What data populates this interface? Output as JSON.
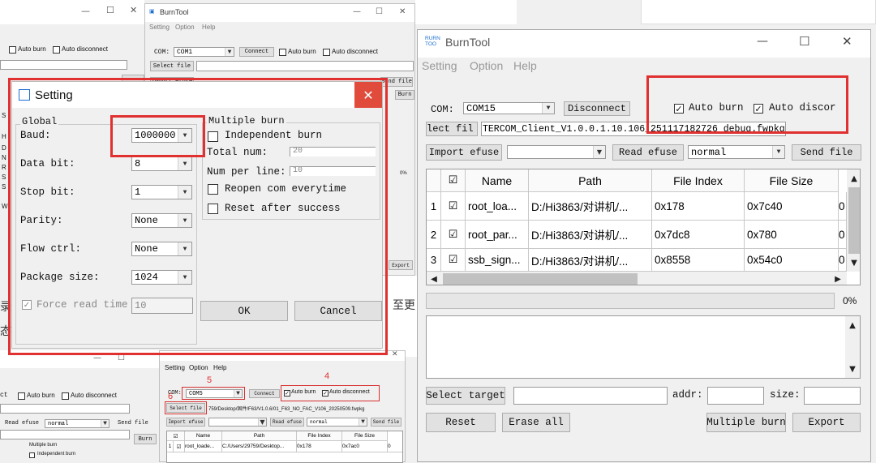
{
  "background_screens": {
    "top_left_window": {
      "auto_burn_label": "Auto burn",
      "auto_disconnect_label": "Auto disconnect",
      "side_letters": [
        "S",
        "H",
        "D",
        "N",
        "R",
        "S",
        "S",
        "W"
      ]
    },
    "top_middle_window": {
      "title": "BurnTool",
      "menu": [
        "Setting",
        "Option",
        "Help"
      ],
      "com_label": "COM:",
      "com_value": "COM1",
      "connect_label": "Connect",
      "auto_burn_label": "Auto burn",
      "auto_disconnect_label": "Auto disconnect",
      "select_file_label": "Select file",
      "import_efuse_label": "Import efuse",
      "send_file_label": "Send file",
      "burn_label": "Burn",
      "progress_text": "0%",
      "export_label": "Export"
    },
    "doc_text": {
      "left_char_1": "录",
      "left_char_2": "态",
      "right_text": "至更"
    },
    "bottom_left_window": {
      "ct_label": "ct",
      "auto_burn_label": "Auto burn",
      "auto_disconnect_label": "Auto disconnect",
      "read_efuse_label": "Read efuse",
      "mode_value": "normal",
      "send_file_label": "Send file",
      "multiple_burn_label": "Multiple burn",
      "independent_burn_label": "Independent burn",
      "burn_label": "Burn"
    },
    "bottom_middle_window": {
      "title": "BurnTool",
      "menu": [
        "Setting",
        "Option",
        "Help"
      ],
      "annotation_5": "5",
      "annotation_4": "4",
      "annotation_6": "6",
      "com_label": "COM:",
      "com_value": "COM5",
      "connect_label": "Connect",
      "auto_burn_label": "Auto burn",
      "auto_disconnect_label": "Auto disconnect",
      "select_file_label": "Select file",
      "file_path": "759/Desktop/固件/F63/V1.0.6/01_F63_NO_FAC_V106_20250509.fwpkg",
      "import_efuse_label": "Import efuse",
      "read_efuse_label": "Read efuse",
      "mode_value": "normal",
      "send_file_label": "Send file",
      "columns": [
        "Name",
        "Path",
        "File Index",
        "File Size"
      ],
      "row": {
        "num": "1",
        "name": "root_loade...",
        "path": "C:/Users/29759/Desktop...",
        "index": "0x178",
        "size": "0x7ac0",
        "extra": "0"
      }
    }
  },
  "setting_dialog": {
    "title": "Setting",
    "close_glyph": "✕",
    "global_group": "Global",
    "baud_label": "Baud:",
    "baud_value": "1000000",
    "data_bit_label": "Data bit:",
    "data_bit_value": "8",
    "stop_bit_label": "Stop bit:",
    "stop_bit_value": "1",
    "parity_label": "Parity:",
    "parity_value": "None",
    "flow_label": "Flow ctrl:",
    "flow_value": "None",
    "package_label": "Package size:",
    "package_value": "1024",
    "force_read_label": "Force read time",
    "force_read_value": "10",
    "multiple_group": "Multiple burn",
    "independent_label": "Independent burn",
    "total_num_label": "Total num:",
    "total_num_value": "20",
    "num_per_line_label": "Num per line:",
    "num_per_line_value": "10",
    "reopen_label": "Reopen com everytime",
    "reset_after_label": "Reset after success",
    "ok_label": "OK",
    "cancel_label": "Cancel"
  },
  "main_window": {
    "logo_text": "RURN\nTOO",
    "title": "BurnTool",
    "menu": [
      "Setting",
      "Option",
      "Help"
    ],
    "com_label": "COM:",
    "com_value": "COM15",
    "disconnect_label": "Disconnect",
    "auto_burn_label": "Auto burn",
    "auto_disconnect_label": "Auto discor",
    "select_file_label": "lect fil",
    "file_path": "TERCOM_Client_V1.0.0.1.10.106_251117182726_debug.fwpkg",
    "import_efuse_label": "Import efuse",
    "read_efuse_label": "Read efuse",
    "mode_value": "normal",
    "send_file_label": "Send file",
    "columns": [
      "Name",
      "Path",
      "File Index",
      "File Size"
    ],
    "rows": [
      {
        "num": "1",
        "name": "root_loa...",
        "path": "D:/Hi3863/对讲机/...",
        "index": "0x178",
        "size": "0x7c40",
        "extra": "0"
      },
      {
        "num": "2",
        "name": "root_par...",
        "path": "D:/Hi3863/对讲机/...",
        "index": "0x7dc8",
        "size": "0x780",
        "extra": "0"
      },
      {
        "num": "3",
        "name": "ssb_sign...",
        "path": "D:/Hi3863/对讲机/...",
        "index": "0x8558",
        "size": "0x54c0",
        "extra": "0"
      }
    ],
    "progress_value": 0,
    "progress_text": "0%",
    "select_target_label": "Select target",
    "addr_label": "addr:",
    "size_label": "size:",
    "reset_label": "Reset",
    "erase_all_label": "Erase all",
    "multiple_burn_label": "Multiple burn",
    "export_label": "Export"
  },
  "colors": {
    "highlight_red": "#e03030",
    "close_red": "#e04b3b",
    "accent_blue": "#1c6fd0"
  }
}
